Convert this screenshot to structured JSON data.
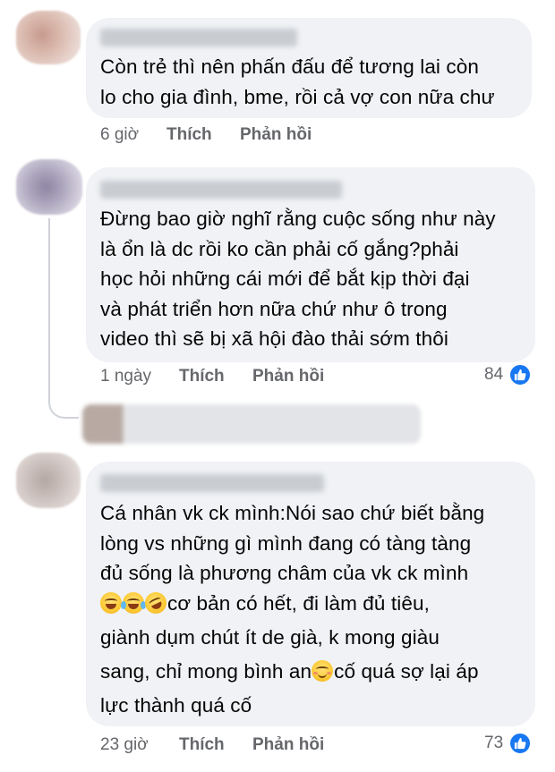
{
  "comments": [
    {
      "lines": [
        "Còn trẻ thì nên phấn đấu để tương lai còn",
        "lo cho gia đình, bme, rồi cả vợ con nữa chư"
      ],
      "time": "6 giờ",
      "like_label": "Thích",
      "reply_label": "Phản hồi"
    },
    {
      "lines": [
        "Đừng bao giờ nghĩ rằng cuộc sống như này",
        "là ổn là dc rồi ko cần phải cố gắng?phải",
        "học hỏi những cái mới để bắt kịp thời đại",
        "và phát triển hơn nữa chứ như ô trong",
        "video thì sẽ bị xã hội đào thải sớm thôi"
      ],
      "time": "1 ngày",
      "like_label": "Thích",
      "reply_label": "Phản hồi",
      "reaction_count": "84"
    },
    {
      "lines": [
        "Cá nhân vk ck mình:Nói sao chứ biết bằng",
        "lòng vs những gì mình đang có tàng tàng",
        "đủ sống là phương châm của vk ck mình",
        "cơ bản có hết, đi làm đủ tiêu,",
        "giành dụm chút ít de già, k mong giàu",
        "sang, chỉ mong bình an",
        "cố quá sợ lại áp",
        "lực thành quá cố"
      ],
      "time": "23 giờ",
      "like_label": "Thích",
      "reply_label": "Phản hồi",
      "reaction_count": "73"
    }
  ],
  "icons": {
    "reaction": "like-icon",
    "emoji_1": "sweat-smile-emoji",
    "emoji_2": "crying-laughing-emoji",
    "emoji_3": "rofl-emoji",
    "emoji_4": "smiling-blush-emoji"
  },
  "colors": {
    "bubble": "#f0f2f5",
    "meta_text": "#65676b",
    "like_blue": "#1877f2"
  }
}
